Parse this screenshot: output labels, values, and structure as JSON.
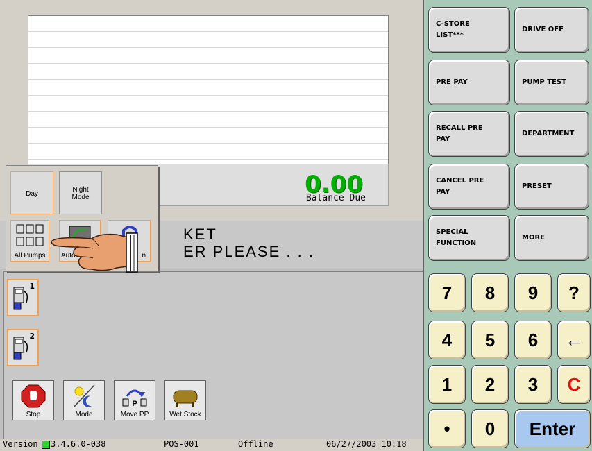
{
  "display": {
    "total_amount": "0.00",
    "total_label": "Balance Due",
    "message_line1": "KET",
    "message_line2": "ER  PLEASE  .  .  ."
  },
  "popup": {
    "day_label": "Day",
    "night_mode_label": "Night\nMode",
    "all_pumps_label": "All Pumps",
    "auto_label": "Auto",
    "third_label": "n"
  },
  "pumps": [
    {
      "number": "1"
    },
    {
      "number": "2"
    }
  ],
  "tools": {
    "stop": "Stop",
    "mode": "Mode",
    "move_pp": "Move PP",
    "wet_stock": "Wet Stock"
  },
  "status": {
    "version_label": "Version",
    "version": "3.4.6.0-038",
    "register": "POS-001",
    "connection": "Offline",
    "datetime": "06/27/2003 10:18"
  },
  "functions": {
    "cstore_list": "C-STORE LIST***",
    "drive_off": "DRIVE OFF",
    "pre_pay": "PRE PAY",
    "pump_test": "PUMP TEST",
    "recall_pre_pay": "RECALL PRE PAY",
    "department": "DEPARTMENT",
    "cancel_pre_pay": "CANCEL PRE PAY",
    "preset": "PRESET",
    "special_function": "SPECIAL FUNCTION",
    "more": "MORE"
  },
  "keypad": {
    "k7": "7",
    "k8": "8",
    "k9": "9",
    "help": "?",
    "k4": "4",
    "k5": "5",
    "k6": "6",
    "back": "←",
    "k1": "1",
    "k2": "2",
    "k3": "3",
    "clear": "C",
    "dot": "•",
    "k0": "0",
    "enter": "Enter"
  },
  "colors": {
    "total_green": "#00b000",
    "clear_red": "#e01010",
    "enter_blue": "#a8c8f0",
    "keypad_bg": "#f6f0c8",
    "panel_teal": "#a8c8b8",
    "pump_border_orange": "#f2a050"
  }
}
